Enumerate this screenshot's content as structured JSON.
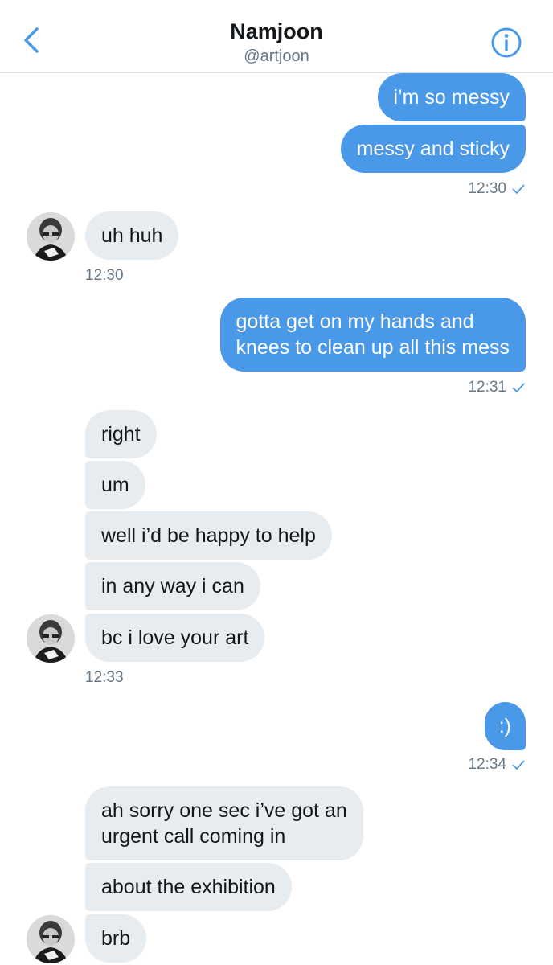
{
  "header": {
    "name": "Namjoon",
    "handle": "@artjoon"
  },
  "colors": {
    "accent": "#4a99e9",
    "incoming_bubble": "#e6ecf0",
    "meta_text": "#657786"
  },
  "icons": {
    "back": "chevron-left-icon",
    "info": "info-icon",
    "read": "checkmark-icon"
  },
  "messages": [
    {
      "from": "me",
      "text": "i’m so messy"
    },
    {
      "from": "me",
      "text": "messy and sticky",
      "time": "12:30"
    },
    {
      "from": "them",
      "text": "uh huh",
      "time": "12:30"
    },
    {
      "from": "me",
      "lines": [
        "gotta get on my hands and",
        "knees to clean up all this mess"
      ],
      "time": "12:31"
    },
    {
      "from": "them",
      "text": "right"
    },
    {
      "from": "them",
      "text": "um"
    },
    {
      "from": "them",
      "text": "well i’d be happy to help"
    },
    {
      "from": "them",
      "text": "in any way i can"
    },
    {
      "from": "them",
      "text": "bc i love your art",
      "time": "12:33"
    },
    {
      "from": "me",
      "text": ":)",
      "time": "12:34"
    },
    {
      "from": "them",
      "lines": [
        "ah sorry one sec i’ve got an",
        "urgent call coming in"
      ]
    },
    {
      "from": "them",
      "text": "about the exhibition"
    },
    {
      "from": "them",
      "text": "brb"
    }
  ]
}
